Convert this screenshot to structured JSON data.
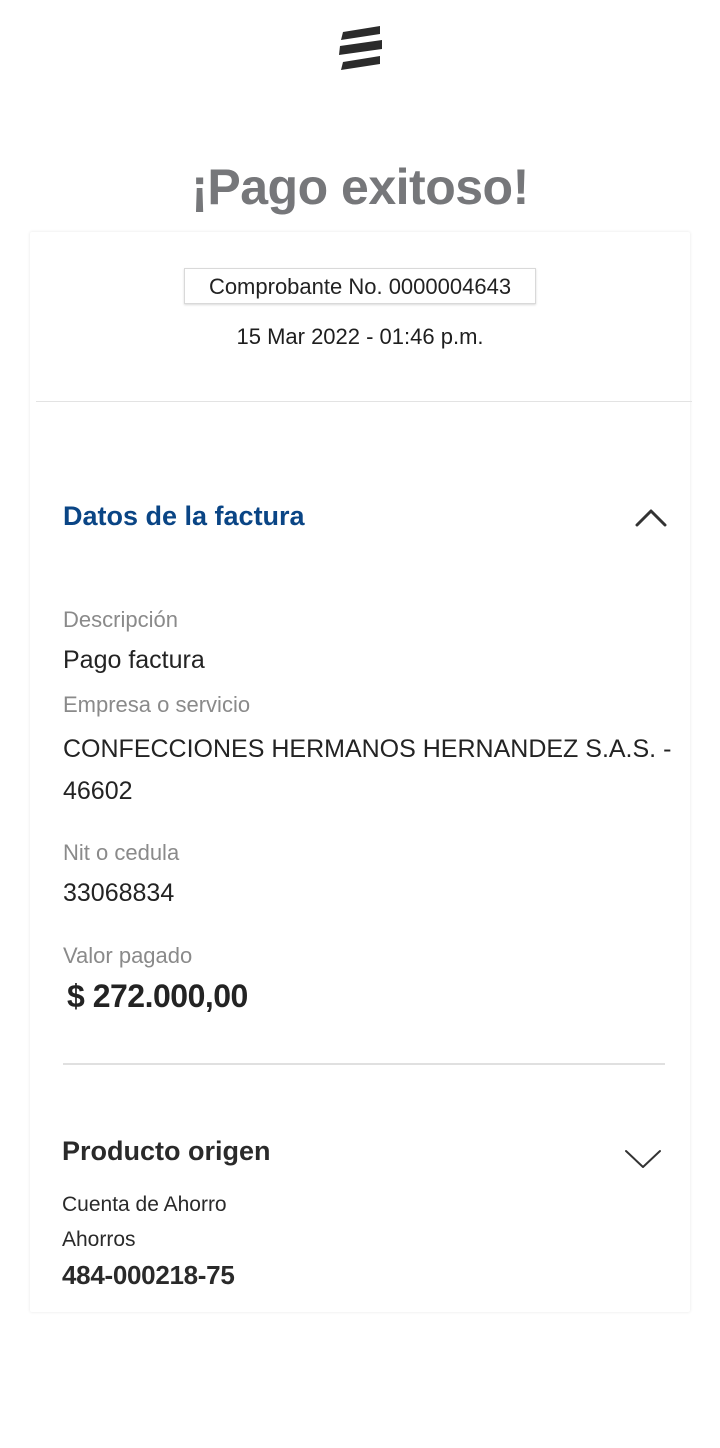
{
  "header": {
    "logo_icon": "bank-logo-icon",
    "title": "¡Pago exitoso!"
  },
  "receipt": {
    "voucher": "Comprobante No. 0000004643",
    "datetime": "15 Mar 2022 - 01:46 p.m."
  },
  "invoice_section": {
    "title": "Datos de la factura",
    "toggle_icon": "chevron-up-icon",
    "description_label": "Descripción",
    "description_value": "Pago factura",
    "company_label": "Empresa o servicio",
    "company_value": "CONFECCIONES HERMANOS HERNANDEZ S.A.S. - 46602",
    "nit_label": "Nit o cedula",
    "nit_value": "33068834",
    "amount_label": "Valor pagado",
    "amount_value": "$ 272.000,00"
  },
  "origin_section": {
    "title": "Producto origen",
    "toggle_icon": "chevron-down-icon",
    "account_type": "Cuenta de Ahorro",
    "account_kind": "Ahorros",
    "account_number": "484-000218-75"
  },
  "colors": {
    "title_gray": "#76777a",
    "section_blue": "#0a4585",
    "label_gray": "#8a8a8a",
    "text_dark": "#232323"
  }
}
